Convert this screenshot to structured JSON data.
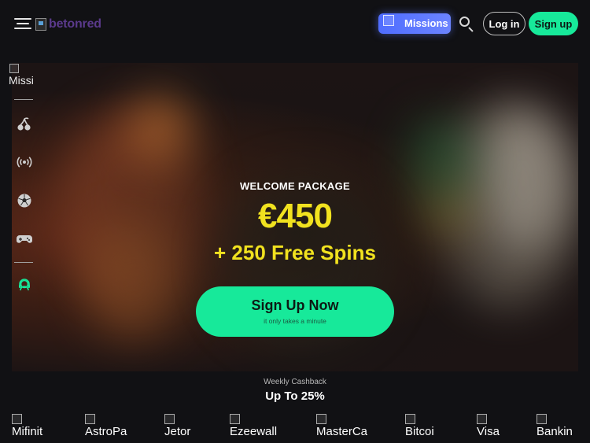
{
  "header": {
    "logo_text": "betonred",
    "missions_label": "Missions",
    "login_label": "Log in",
    "signup_label": "Sign up"
  },
  "rail": {
    "missions_alt": "Missi",
    "items": [
      {
        "icon": "cherry-icon"
      },
      {
        "icon": "live-broadcast-icon"
      },
      {
        "icon": "soccer-ball-icon"
      },
      {
        "icon": "gamepad-icon"
      },
      {
        "icon": "support-agent-icon"
      }
    ]
  },
  "hero": {
    "welcome": "WELCOME PACKAGE",
    "amount": "€450",
    "spins": "+ 250 Free Spins",
    "cta_title": "Sign Up Now",
    "cta_sub": "it only takes a minute"
  },
  "promo": {
    "small": "Weekly Cashback",
    "big": "Up To 25%"
  },
  "payments": [
    "Mifinit",
    "AstroPa",
    "Jetor",
    "Ezeewall",
    "MasterCa",
    "Bitcoi",
    "Visa",
    "Bankin"
  ],
  "colors": {
    "accent_green": "#17e99a",
    "accent_yellow": "#f1e21f",
    "missions_blue": "#5a75ff",
    "background": "#111114"
  }
}
